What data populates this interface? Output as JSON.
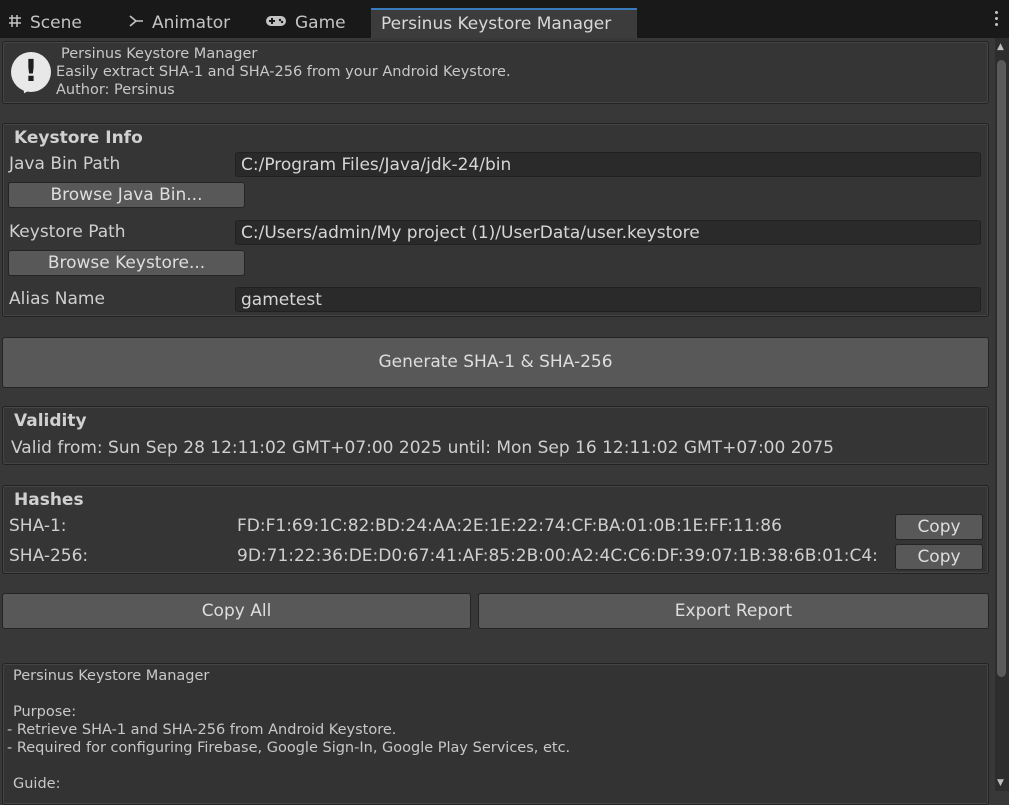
{
  "tabs": [
    {
      "label": "Scene",
      "icon": "grid-icon"
    },
    {
      "label": "Animator",
      "icon": "animator-icon"
    },
    {
      "label": "Game",
      "icon": "gamepad-icon"
    },
    {
      "label": "Persinus Keystore Manager",
      "active": true
    }
  ],
  "header": {
    "title": "Persinus Keystore Manager",
    "description": "Easily extract SHA-1 and SHA-256 from your Android Keystore.",
    "author": "Author: Persinus"
  },
  "keystore_info": {
    "title": "Keystore Info",
    "java_bin_label": "Java Bin Path",
    "java_bin_value": "C:/Program Files/Java/jdk-24/bin",
    "browse_java_label": "Browse Java Bin...",
    "keystore_label": "Keystore Path",
    "keystore_value": "C:/Users/admin/My project (1)/UserData/user.keystore",
    "browse_keystore_label": "Browse Keystore...",
    "alias_label": "Alias Name",
    "alias_value": "gametest"
  },
  "generate_label": "Generate SHA-1 & SHA-256",
  "validity": {
    "title": "Validity",
    "text": "Valid from: Sun Sep 28 12:11:02 GMT+07:00 2025 until: Mon Sep 16 12:11:02 GMT+07:00 2075"
  },
  "hashes": {
    "title": "Hashes",
    "sha1_label": "SHA-1:",
    "sha1_value": "FD:F1:69:1C:82:BD:24:AA:2E:1E:22:74:CF:BA:01:0B:1E:FF:11:86",
    "sha256_label": "SHA-256:",
    "sha256_value": "9D:71:22:36:DE:D0:67:41:AF:85:2B:00:A2:4C:C6:DF:39:07:1B:38:6B:01:C4:",
    "copy_label": "Copy"
  },
  "actions": {
    "copy_all_label": "Copy All",
    "export_label": "Export Report"
  },
  "info": {
    "title": "Persinus Keystore Manager",
    "purpose_heading": "Purpose:",
    "purpose_1": "- Retrieve SHA-1 and SHA-256 from Android Keystore.",
    "purpose_2": "- Required for configuring Firebase, Google Sign-In, Google Play Services, etc.",
    "guide_heading": "Guide:"
  },
  "colors": {
    "background": "#383838",
    "tab_accent": "#3a79bb",
    "button": "#585858"
  }
}
